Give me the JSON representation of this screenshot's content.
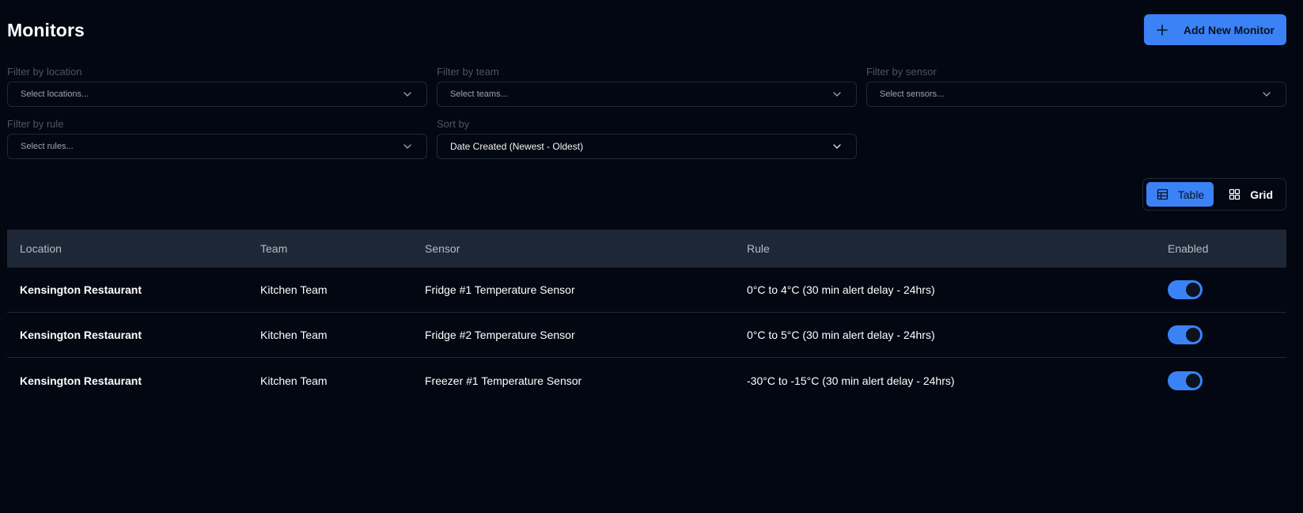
{
  "header": {
    "title": "Monitors",
    "add_button_label": "Add New Monitor"
  },
  "filters": [
    {
      "label": "Filter by location",
      "placeholder": "Select locations..."
    },
    {
      "label": "Filter by team",
      "placeholder": "Select teams..."
    },
    {
      "label": "Filter by sensor",
      "placeholder": "Select sensors..."
    },
    {
      "label": "Filter by rule",
      "placeholder": "Select rules..."
    },
    {
      "label": "Sort by",
      "value": "Date Created (Newest - Oldest)"
    }
  ],
  "view_toggle": {
    "table_label": "Table",
    "grid_label": "Grid",
    "active": "table"
  },
  "table": {
    "columns": [
      "Location",
      "Team",
      "Sensor",
      "Rule",
      "Enabled"
    ],
    "rows": [
      {
        "location": "Kensington Restaurant",
        "team": "Kitchen Team",
        "sensor": "Fridge #1 Temperature Sensor",
        "rule": "0°C to 4°C (30 min alert delay - 24hrs)",
        "enabled": true
      },
      {
        "location": "Kensington Restaurant",
        "team": "Kitchen Team",
        "sensor": "Fridge #2 Temperature Sensor",
        "rule": "0°C to 5°C (30 min alert delay - 24hrs)",
        "enabled": true
      },
      {
        "location": "Kensington Restaurant",
        "team": "Kitchen Team",
        "sensor": "Freezer #1 Temperature Sensor",
        "rule": "-30°C to -15°C (30 min alert delay - 24hrs)",
        "enabled": true
      }
    ]
  },
  "colors": {
    "background": "#030712",
    "accent": "#3b82f6",
    "table_header": "#1e2736",
    "border": "#1f2937"
  }
}
